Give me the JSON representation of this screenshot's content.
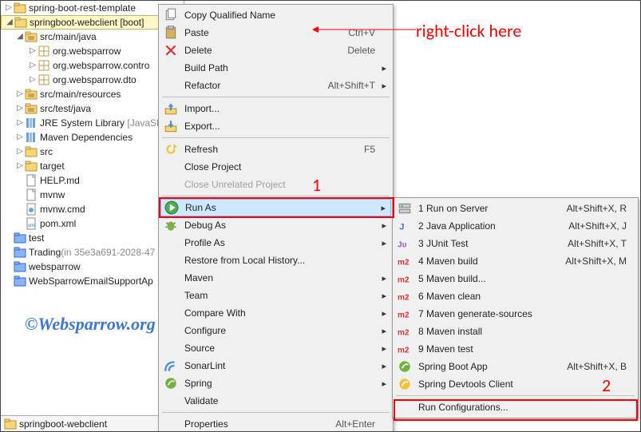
{
  "explorer": {
    "items": [
      {
        "label": "spring-boot-rest-template",
        "level": 0,
        "arrow": "▷",
        "icon": "folder-j"
      },
      {
        "label": "springboot-webclient [boot]",
        "level": 0,
        "arrow": "◢",
        "icon": "folder-j",
        "selected": true,
        "suffix": ""
      },
      {
        "label": "src/main/java",
        "level": 1,
        "arrow": "◢",
        "icon": "src-folder"
      },
      {
        "label": "org.websparrow",
        "level": 2,
        "arrow": "▷",
        "icon": "package"
      },
      {
        "label": "org.websparrow.contro",
        "level": 2,
        "arrow": "▷",
        "icon": "package"
      },
      {
        "label": "org.websparrow.dto",
        "level": 2,
        "arrow": "▷",
        "icon": "package"
      },
      {
        "label": "src/main/resources",
        "level": 1,
        "arrow": "▷",
        "icon": "src-folder"
      },
      {
        "label": "src/test/java",
        "level": 1,
        "arrow": "▷",
        "icon": "src-folder"
      },
      {
        "label": "JRE System Library",
        "level": 1,
        "arrow": "▷",
        "icon": "library",
        "suffix": " [JavaSE"
      },
      {
        "label": "Maven Dependencies",
        "level": 1,
        "arrow": "▷",
        "icon": "library"
      },
      {
        "label": "src",
        "level": 1,
        "arrow": "▷",
        "icon": "folder"
      },
      {
        "label": "target",
        "level": 1,
        "arrow": "▷",
        "icon": "folder"
      },
      {
        "label": "HELP.md",
        "level": 1,
        "arrow": "",
        "icon": "file"
      },
      {
        "label": "mvnw",
        "level": 1,
        "arrow": "",
        "icon": "file"
      },
      {
        "label": "mvnw.cmd",
        "level": 1,
        "arrow": "",
        "icon": "file-cmd"
      },
      {
        "label": "pom.xml",
        "level": 1,
        "arrow": "",
        "icon": "file-xml"
      },
      {
        "label": "test",
        "level": 0,
        "arrow": "",
        "icon": "blue-folder"
      },
      {
        "label": "Trading",
        "level": 0,
        "arrow": "",
        "icon": "blue-folder",
        "suffix": " (in 35e3a691-2028-47",
        "graySuffix": true
      },
      {
        "label": "websparrow",
        "level": 0,
        "arrow": "",
        "icon": "blue-folder"
      },
      {
        "label": "WebSparrowEmailSupportAp",
        "level": 0,
        "arrow": "",
        "icon": "blue-folder"
      }
    ]
  },
  "status": {
    "label": "springboot-webclient",
    "icon": "folder-j"
  },
  "menu1": [
    {
      "label": "Copy Qualified Name",
      "icon": "copy"
    },
    {
      "label": "Paste",
      "icon": "paste",
      "accel": "Ctrl+V"
    },
    {
      "label": "Delete",
      "icon": "delete",
      "accel": "Delete"
    },
    {
      "label": "Build Path",
      "sub": true
    },
    {
      "label": "Refactor",
      "accel": "Alt+Shift+T",
      "sub": true
    },
    {
      "sep": true
    },
    {
      "label": "Import...",
      "icon": "import"
    },
    {
      "label": "Export...",
      "icon": "export"
    },
    {
      "sep": true
    },
    {
      "label": "Refresh",
      "icon": "refresh",
      "accel": "F5"
    },
    {
      "label": "Close Project"
    },
    {
      "label": "Close Unrelated Project",
      "disabled": true
    },
    {
      "sep": true
    },
    {
      "label": "Run As",
      "icon": "run",
      "sub": true,
      "highlight": true
    },
    {
      "label": "Debug As",
      "icon": "debug",
      "sub": true
    },
    {
      "label": "Profile As",
      "sub": true
    },
    {
      "label": "Restore from Local History..."
    },
    {
      "label": "Maven",
      "sub": true
    },
    {
      "label": "Team",
      "sub": true
    },
    {
      "label": "Compare With",
      "sub": true
    },
    {
      "label": "Configure",
      "sub": true
    },
    {
      "label": "Source",
      "sub": true
    },
    {
      "label": "SonarLint",
      "icon": "sonar",
      "sub": true
    },
    {
      "label": "Spring",
      "icon": "spring",
      "sub": true
    },
    {
      "label": "Validate"
    },
    {
      "sep": true
    },
    {
      "label": "Properties",
      "accel": "Alt+Enter"
    }
  ],
  "menu2": [
    {
      "label": "1 Run on Server",
      "icon": "server",
      "accel": "Alt+Shift+X, R"
    },
    {
      "label": "2 Java Application",
      "icon": "java",
      "accel": "Alt+Shift+X, J"
    },
    {
      "label": "3 JUnit Test",
      "icon": "junit",
      "accel": "Alt+Shift+X, T"
    },
    {
      "label": "4 Maven build",
      "icon": "m2",
      "accel": "Alt+Shift+X, M"
    },
    {
      "label": "5 Maven build...",
      "icon": "m2"
    },
    {
      "label": "6 Maven clean",
      "icon": "m2"
    },
    {
      "label": "7 Maven generate-sources",
      "icon": "m2"
    },
    {
      "label": "8 Maven install",
      "icon": "m2"
    },
    {
      "label": "9 Maven test",
      "icon": "m2"
    },
    {
      "label": "Spring Boot App",
      "icon": "spring",
      "accel": "Alt+Shift+X, B"
    },
    {
      "label": "Spring Devtools Client",
      "icon": "spring-y"
    },
    {
      "sep": true
    },
    {
      "label": "Run Configurations..."
    }
  ],
  "annotations": {
    "rightClick": "right-click here",
    "num1": "1",
    "num2": "2",
    "watermark": "©Websparrow.org"
  }
}
